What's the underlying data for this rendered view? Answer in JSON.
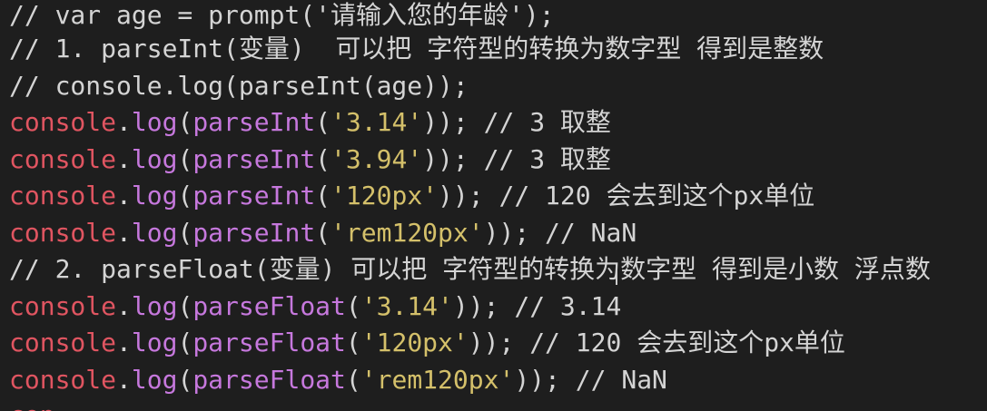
{
  "editor": {
    "lines": [
      {
        "type": "comment",
        "text": "// var age = prompt('请输入您的年龄');"
      },
      {
        "type": "comment",
        "text": "// 1. parseInt(变量)  可以把 字符型的转换为数字型 得到是整数"
      },
      {
        "type": "comment",
        "text": "// console.log(parseInt(age));"
      },
      {
        "type": "code",
        "obj": "console",
        "dot": ".",
        "method": "log",
        "open": "(",
        "fn": "parseInt",
        "open2": "(",
        "arg": "'3.14'",
        "close": "));",
        "comment": " // 3 取整"
      },
      {
        "type": "code",
        "obj": "console",
        "dot": ".",
        "method": "log",
        "open": "(",
        "fn": "parseInt",
        "open2": "(",
        "arg": "'3.94'",
        "close": "));",
        "comment": " // 3 取整"
      },
      {
        "type": "code",
        "obj": "console",
        "dot": ".",
        "method": "log",
        "open": "(",
        "fn": "parseInt",
        "open2": "(",
        "arg": "'120px'",
        "close": "));",
        "comment": " // 120 会去到这个px单位"
      },
      {
        "type": "code",
        "obj": "console",
        "dot": ".",
        "method": "log",
        "open": "(",
        "fn": "parseInt",
        "open2": "(",
        "arg": "'rem120px'",
        "close": "));",
        "comment": " // NaN"
      },
      {
        "type": "comment",
        "text": "// 2. parseFloat(变量) 可以把 字符型的转换为数字型 得到是小数 浮点数"
      },
      {
        "type": "code",
        "obj": "console",
        "dot": ".",
        "method": "log",
        "open": "(",
        "fn": "parseFloat",
        "open2": "(",
        "arg": "'3.14'",
        "close": "));",
        "comment": " // 3.14"
      },
      {
        "type": "code",
        "obj": "console",
        "dot": ".",
        "method": "log",
        "open": "(",
        "fn": "parseFloat",
        "open2": "(",
        "arg": "'120px'",
        "close": "));",
        "comment": " // 120 会去到这个px单位"
      },
      {
        "type": "code",
        "obj": "console",
        "dot": ".",
        "method": "log",
        "open": "(",
        "fn": "parseFloat",
        "open2": "(",
        "arg": "'rem120px'",
        "close": "));",
        "comment": " // NaN"
      }
    ]
  },
  "colors": {
    "background": "#1e1e1e",
    "text": "#d4d4d4",
    "object": "#e05561",
    "function": "#c678dd",
    "string": "#d4c06a"
  }
}
